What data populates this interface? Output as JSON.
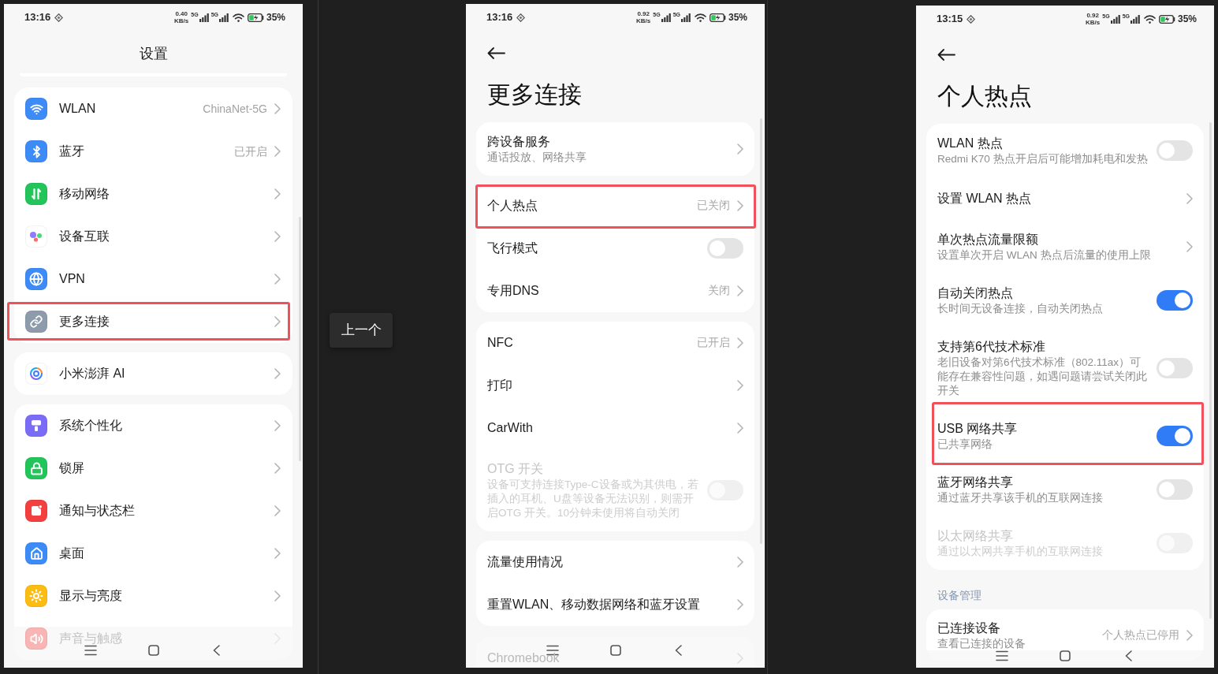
{
  "left_screen": {
    "status_bar": {
      "time": "13:16",
      "speed_value": "0.40",
      "speed_unit": "KB/s",
      "networks": [
        "5G",
        "5G"
      ],
      "battery": "35%"
    },
    "title": "设置",
    "groups": [
      {
        "items": [
          {
            "label": "WLAN",
            "value": "ChinaNet-5G",
            "color": "#3d8bf7",
            "highlighted": false
          },
          {
            "label": "蓝牙",
            "value": "已开启",
            "color": "#3d8bf7",
            "highlighted": false
          },
          {
            "label": "移动网络",
            "color": "#22c55a",
            "highlighted": false
          },
          {
            "label": "设备互联",
            "color": "#ffffff",
            "highlighted": false
          },
          {
            "label": "VPN",
            "color": "#3d8bf7",
            "highlighted": false
          },
          {
            "label": "更多连接",
            "color": "#8e9bab",
            "highlighted": true
          }
        ]
      },
      {
        "items": [
          {
            "label": "小米澎湃 AI",
            "color": "#ffffff",
            "highlighted": false
          }
        ]
      },
      {
        "items": [
          {
            "label": "系统个性化",
            "color": "#7a6cf7",
            "highlighted": false
          },
          {
            "label": "锁屏",
            "color": "#22c55a",
            "highlighted": false
          },
          {
            "label": "通知与状态栏",
            "color": "#f43f3f",
            "highlighted": false
          },
          {
            "label": "桌面",
            "color": "#3d8bf7",
            "highlighted": false
          },
          {
            "label": "显示与亮度",
            "color": "#fcbc12",
            "highlighted": false
          },
          {
            "label": "声音与触感",
            "color": "#f9b4b4",
            "highlighted": false
          }
        ]
      }
    ]
  },
  "tooltip": {
    "text": "上一个"
  },
  "middle_screen": {
    "status_bar": {
      "time": "13:16",
      "speed_value": "0.92",
      "speed_unit": "KB/s",
      "networks": [
        "5G",
        "5G"
      ],
      "battery": "35%"
    },
    "title": "更多连接",
    "groups": [
      {
        "items": [
          {
            "kind": "link",
            "label": "跨设备服务",
            "subtitle": "通话投放、网络共享",
            "disabled": false,
            "highlighted": false
          }
        ]
      },
      {
        "items": [
          {
            "kind": "link",
            "label": "个人热点",
            "value": "已关闭",
            "disabled": false,
            "highlighted": true
          },
          {
            "kind": "toggle",
            "label": "飞行模式",
            "on": false,
            "disabled": false,
            "highlighted": false
          },
          {
            "kind": "link",
            "label": "专用DNS",
            "value": "关闭",
            "disabled": false,
            "highlighted": false
          }
        ]
      },
      {
        "items": [
          {
            "kind": "link",
            "label": "NFC",
            "value": "已开启",
            "disabled": false,
            "highlighted": false
          },
          {
            "kind": "link",
            "label": "打印",
            "disabled": false,
            "highlighted": false
          },
          {
            "kind": "link",
            "label": "CarWith",
            "disabled": false,
            "highlighted": false
          },
          {
            "kind": "toggle",
            "label": "OTG 开关",
            "subtitle": "设备可支持连接Type-C设备或为其供电，若插入的耳机、U盘等设备无法识别，则需开启OTG 开关。10分钟未使用将自动关闭",
            "on": false,
            "disabled": true,
            "highlighted": false
          }
        ]
      },
      {
        "items": [
          {
            "kind": "link",
            "label": "流量使用情况",
            "disabled": false,
            "highlighted": false
          },
          {
            "kind": "link",
            "label": "重置WLAN、移动数据网络和蓝牙设置",
            "disabled": false,
            "highlighted": false
          }
        ]
      },
      {
        "items": [
          {
            "kind": "link",
            "label": "Chromebook",
            "disabled": false,
            "highlighted": false
          }
        ]
      }
    ]
  },
  "right_screen": {
    "status_bar": {
      "time": "13:15",
      "speed_value": "0.92",
      "speed_unit": "KB/s",
      "networks": [
        "5G",
        "5G"
      ],
      "battery": "35%"
    },
    "title": "个人热点",
    "groups": [
      {
        "items": [
          {
            "kind": "toggle",
            "label": "WLAN 热点",
            "subtitle": "Redmi K70 热点开启后可能增加耗电和发热",
            "on": false,
            "disabled": false,
            "highlighted": false
          },
          {
            "kind": "link",
            "label": "设置 WLAN 热点",
            "disabled": false,
            "highlighted": false
          },
          {
            "kind": "link",
            "label": "单次热点流量限额",
            "subtitle": "设置单次开启 WLAN 热点后流量的使用上限",
            "disabled": false,
            "highlighted": false
          },
          {
            "kind": "toggle",
            "label": "自动关闭热点",
            "subtitle": "长时间无设备连接，自动关闭热点",
            "on": true,
            "disabled": false,
            "highlighted": false
          },
          {
            "kind": "toggle",
            "label": "支持第6代技术标准",
            "subtitle": "老旧设备对第6代技术标准（802.11ax）可能存在兼容性问题，如遇问题请尝试关闭此开关",
            "on": false,
            "disabled": false,
            "highlighted": false
          },
          {
            "kind": "toggle",
            "label": "USB 网络共享",
            "subtitle": "已共享网络",
            "on": true,
            "disabled": false,
            "highlighted": true
          },
          {
            "kind": "toggle",
            "label": "蓝牙网络共享",
            "subtitle": "通过蓝牙共享该手机的互联网连接",
            "on": false,
            "disabled": false,
            "highlighted": false
          },
          {
            "kind": "toggle",
            "label": "以太网络共享",
            "subtitle": "通过以太网共享手机的互联网连接",
            "on": false,
            "disabled": true,
            "highlighted": false
          }
        ]
      },
      {
        "header": "设备管理",
        "items": [
          {
            "kind": "link",
            "label": "已连接设备",
            "subtitle": "查看已连接的设备",
            "value": "个人热点已停用",
            "disabled": false,
            "highlighted": false
          }
        ]
      }
    ]
  }
}
